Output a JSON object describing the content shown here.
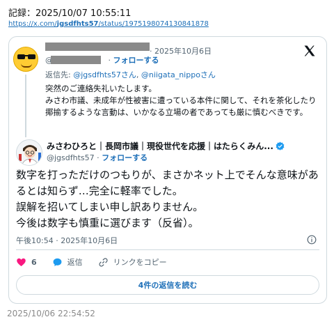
{
  "record": {
    "text": "記録：2025/10/07 10:55:11"
  },
  "source_url": {
    "prefix": "https://x.com/",
    "handle": "jgsdfhts57",
    "suffix": "/status/1975198074130841878"
  },
  "reply_tweet": {
    "handle_prefix": "@",
    "date": "· 2025年10月6日",
    "follow": "フォローする",
    "reply_to_label": "返信先: ",
    "reply_to_1": "@jgsdfhts57さん",
    "reply_to_sep": ", ",
    "reply_to_2": "@niigata_nippoさん",
    "body": "突然のご連絡失礼いたします。\nみさわ市議、未成年が性被害に遭っている本件に関して、それを茶化したり揶揄するような言動は、いかなる立場の者であっても厳に慎むべきです。"
  },
  "main_tweet": {
    "author_name": "みさわひろと｜長岡市議｜現役世代を応援｜はたらくみん...",
    "handle": "@jgsdfhts57",
    "separator": " · ",
    "follow": "フォローする",
    "body": "数字を打っただけのつもりが、まさかネット上でそんな意味があるとは知らず…完全に軽率でした。\n誤解を招いてしまい申し訳ありません。\n今後は数字も慎重に選びます（反省）。",
    "timestamp": "午後10:54 · 2025年10月6日"
  },
  "actions": {
    "like_count": "6",
    "reply_label": "返信",
    "copy_link_label": "リンクをコピー"
  },
  "read_replies_label": "4件の返信を読む",
  "footer": {
    "timestamp": "2025/10/06 22:54:52"
  },
  "colors": {
    "link": "#1d6fb8",
    "like": "#f91880",
    "reply": "#1d9bf0",
    "verified": "#1d9bf0",
    "muted": "#536471"
  },
  "icons": [
    "x-logo-icon",
    "info-icon",
    "heart-icon",
    "reply-bubble-icon",
    "link-icon",
    "verified-badge-icon"
  ]
}
